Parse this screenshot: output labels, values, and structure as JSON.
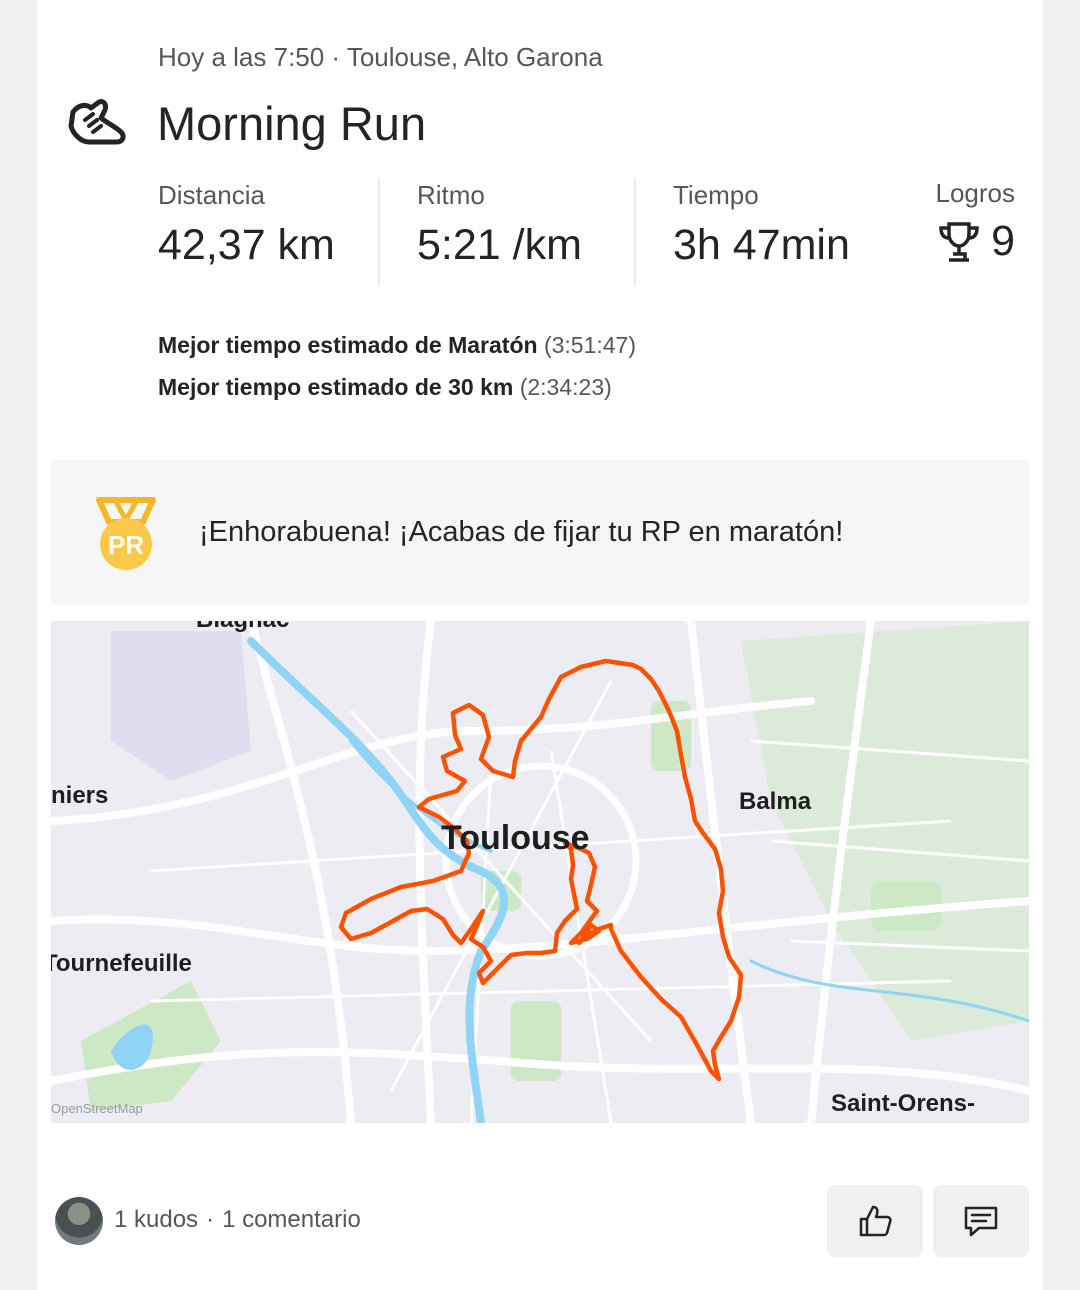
{
  "activity": {
    "meta": "Hoy a las 7:50 · Toulouse, Alto Garona",
    "title": "Morning Run",
    "icon": "running-shoe-icon"
  },
  "stats": [
    {
      "label": "Distancia",
      "value": "42,37 km"
    },
    {
      "label": "Ritmo",
      "value": "5:21 /km"
    },
    {
      "label": "Tiempo",
      "value": "3h 47min"
    }
  ],
  "achievements": {
    "label": "Logros",
    "value": "9",
    "icon": "trophy-icon"
  },
  "best_efforts": [
    {
      "label": "Mejor tiempo estimado de Maratón",
      "time": "(3:51:47)"
    },
    {
      "label": "Mejor tiempo estimado de 30 km",
      "time": "(2:34:23)"
    }
  ],
  "pr_banner": {
    "icon": "pr-medal-icon",
    "badge": "PR",
    "text": "¡Enhorabuena! ¡Acabas de fijar tu RP en maratón!",
    "colors": {
      "medal": "#fcc849",
      "ribbon": "#f5b62a"
    }
  },
  "map": {
    "labels": {
      "top": "Blagnac",
      "left_top": "niers",
      "city": "Toulouse",
      "east": "Balma",
      "west": "Tournefeuille",
      "southeast": "Saint-Orens-",
      "attribution": "OpenStreetMap"
    },
    "route_color": "#fc5200",
    "water_color": "#8fd3f5",
    "park_color": "#c9e8c0"
  },
  "social": {
    "kudos": "1 kudos",
    "separator": "·",
    "comments": "1 comentario",
    "kudos_icon": "thumbs-up-icon",
    "comment_icon": "comment-icon"
  }
}
